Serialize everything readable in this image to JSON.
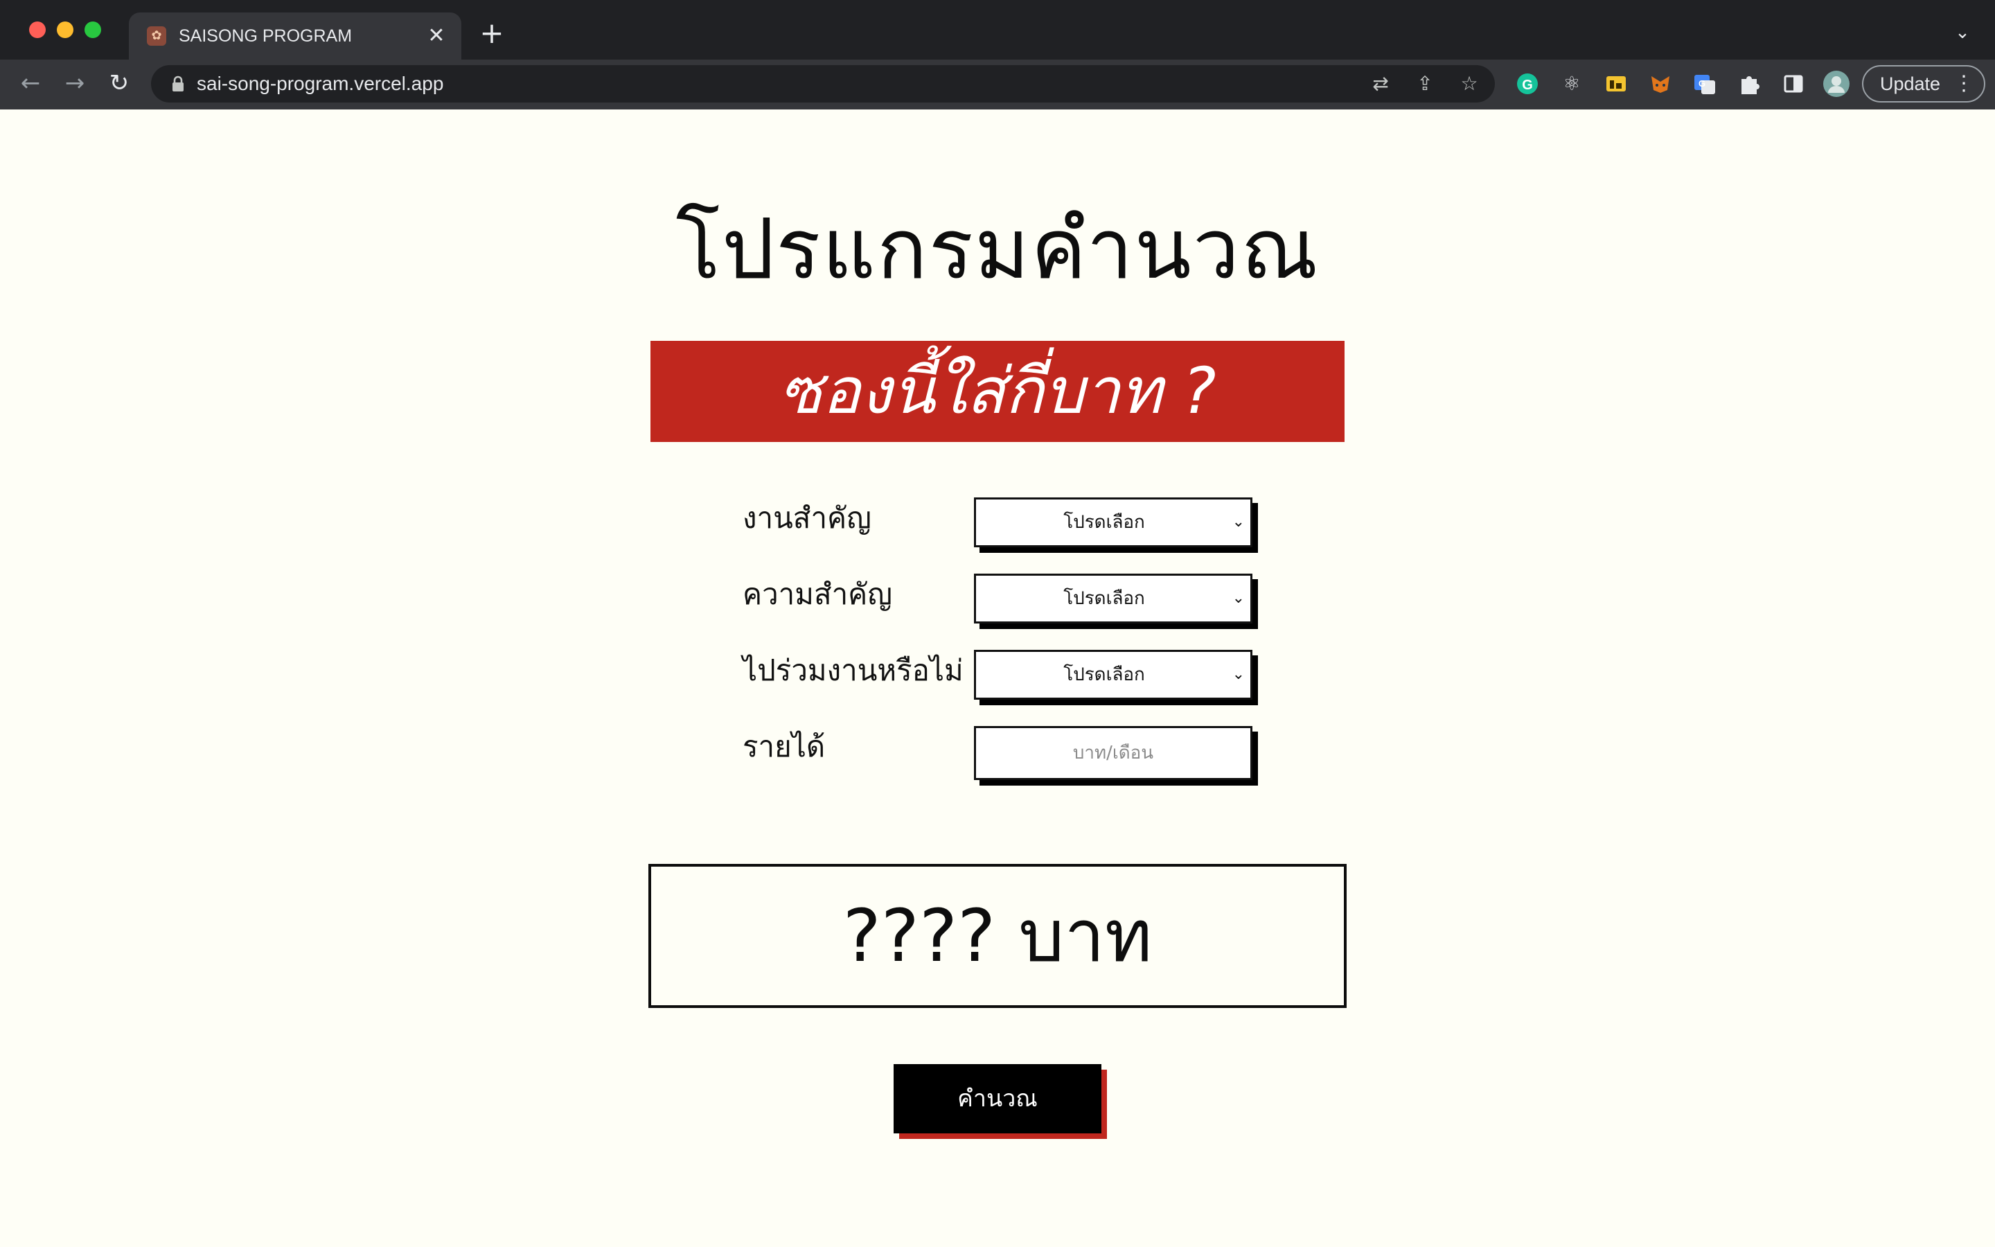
{
  "browser": {
    "tab_title": "SAISONG PROGRAM",
    "tab_close": "✕",
    "new_tab": "+",
    "tab_list": "⌄",
    "url": "sai-song-program.vercel.app",
    "update_label": "Update",
    "update_menu": "⋮",
    "back": "←",
    "forward": "→",
    "reload": "↻"
  },
  "page": {
    "title": "โปรแกรมคำนวณ",
    "subtitle": "ซองนี้ใส่กี่บาท ?",
    "form": {
      "event": {
        "label": "งานสำคัญ",
        "value": "โปรดเลือก"
      },
      "importance": {
        "label": "ความสำคัญ",
        "value": "โปรดเลือก"
      },
      "attend": {
        "label": "ไปร่วมงานหรือไม่",
        "value": "โปรดเลือก"
      },
      "income": {
        "label": "รายได้",
        "placeholder": "บาท/เดือน"
      }
    },
    "result": "???? บาท",
    "calculate_button": "คำนวณ"
  },
  "colors": {
    "accent_red": "#c0271e",
    "page_background": "#fefef6",
    "text": "#0d0d0d"
  }
}
